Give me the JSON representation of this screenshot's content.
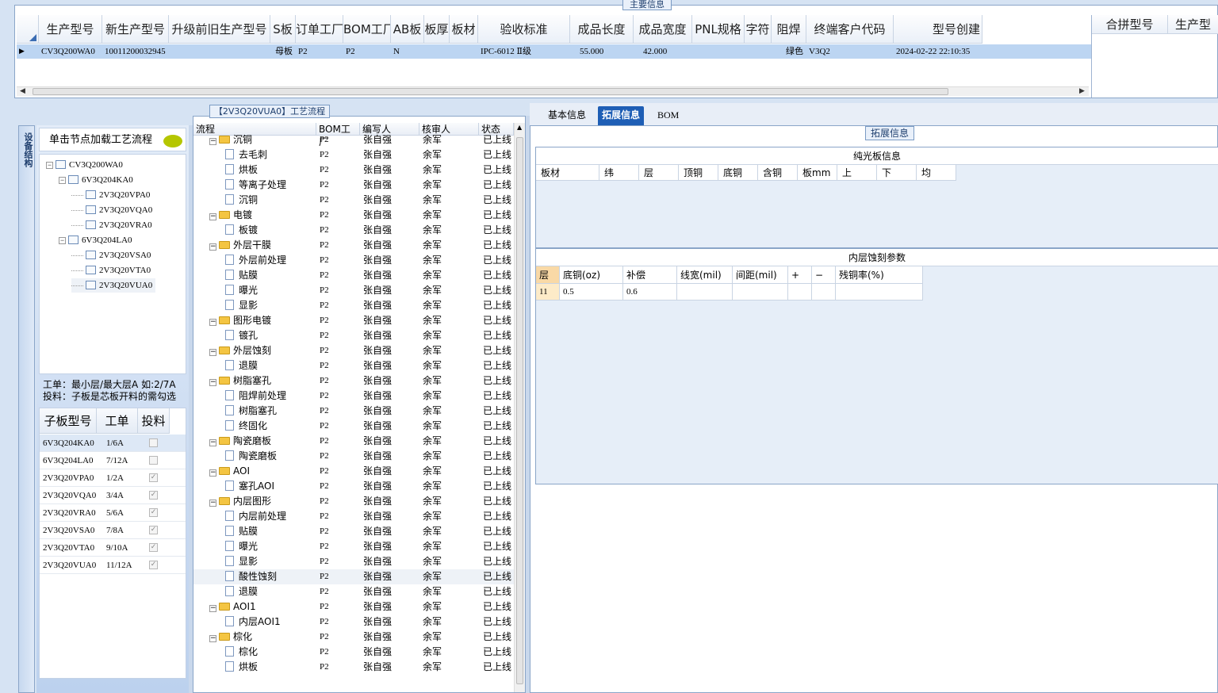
{
  "top_panel": {
    "title": "主要信息",
    "columns": [
      "生产型号",
      "新生产型号",
      "升级前旧生产型号",
      "S板",
      "订单工厂",
      "BOM工厂",
      "AB板",
      "板厚",
      "板材",
      "验收标准",
      "成品长度",
      "成品宽度",
      "PNL规格",
      "字符",
      "阻焊",
      "终端客户代码",
      "型号创建"
    ],
    "row": {
      "marker": "▶",
      "cells": [
        "CV3Q200WA0",
        "10011200032945",
        "",
        "母板",
        "P2",
        "P2",
        "N",
        "",
        "",
        "IPC-6012 Ⅱ级",
        "55.000",
        "42.000",
        "",
        "",
        "绿色",
        "V3Q2",
        "2024-02-22 22:10:35"
      ]
    },
    "merge_columns": [
      "合拼型号",
      "生产型"
    ]
  },
  "left_panel": {
    "vertical_tab": "设备结构",
    "hint": "单击节点加载工艺流程",
    "tree": [
      {
        "label": "CV3Q200WA0",
        "level": 0,
        "expander": "−"
      },
      {
        "label": "6V3Q204KA0",
        "level": 1,
        "expander": "−"
      },
      {
        "label": "2V3Q20VPA0",
        "level": 2
      },
      {
        "label": "2V3Q20VQA0",
        "level": 2
      },
      {
        "label": "2V3Q20VRA0",
        "level": 2
      },
      {
        "label": "6V3Q204LA0",
        "level": 1,
        "expander": "−"
      },
      {
        "label": "2V3Q20VSA0",
        "level": 2
      },
      {
        "label": "2V3Q20VTA0",
        "level": 2
      },
      {
        "label": "2V3Q20VUA0",
        "level": 2,
        "selected": true
      }
    ],
    "note_line1": "工单：最小层/最大层A 如:2/7A",
    "note_line2": "投料：子板是芯板开料的需勾选",
    "subgrid": {
      "headers": [
        "子板型号",
        "工单",
        "投料"
      ],
      "rows": [
        {
          "model": "6V3Q204KA0",
          "order": "1/6A",
          "feed": false,
          "selected": true
        },
        {
          "model": "6V3Q204LA0",
          "order": "7/12A",
          "feed": false
        },
        {
          "model": "2V3Q20VPA0",
          "order": "1/2A",
          "feed": true
        },
        {
          "model": "2V3Q20VQA0",
          "order": "3/4A",
          "feed": true
        },
        {
          "model": "2V3Q20VRA0",
          "order": "5/6A",
          "feed": true
        },
        {
          "model": "2V3Q20VSA0",
          "order": "7/8A",
          "feed": true
        },
        {
          "model": "2V3Q20VTA0",
          "order": "9/10A",
          "feed": true
        },
        {
          "model": "2V3Q20VUA0",
          "order": "11/12A",
          "feed": true
        }
      ]
    }
  },
  "flow_panel": {
    "title": "【2V3Q20VUA0】工艺流程",
    "headers": [
      "流程",
      "BOM工厂",
      "编写人",
      "核审人",
      "状态"
    ],
    "rows": [
      {
        "name": "沉铜",
        "type": "folder",
        "bom": "P2",
        "writer": "张自强",
        "reviewer": "余军",
        "status": "已上线"
      },
      {
        "name": "去毛刺",
        "type": "step",
        "bom": "P2",
        "writer": "张自强",
        "reviewer": "余军",
        "status": "已上线"
      },
      {
        "name": "烘板",
        "type": "step",
        "bom": "P2",
        "writer": "张自强",
        "reviewer": "余军",
        "status": "已上线"
      },
      {
        "name": "等离子处理",
        "type": "step",
        "bom": "P2",
        "writer": "张自强",
        "reviewer": "余军",
        "status": "已上线"
      },
      {
        "name": "沉铜",
        "type": "step",
        "bom": "P2",
        "writer": "张自强",
        "reviewer": "余军",
        "status": "已上线"
      },
      {
        "name": "电镀",
        "type": "folder",
        "bom": "P2",
        "writer": "张自强",
        "reviewer": "余军",
        "status": "已上线"
      },
      {
        "name": "板镀",
        "type": "step",
        "bom": "P2",
        "writer": "张自强",
        "reviewer": "余军",
        "status": "已上线"
      },
      {
        "name": "外层干膜",
        "type": "folder",
        "bom": "P2",
        "writer": "张自强",
        "reviewer": "余军",
        "status": "已上线"
      },
      {
        "name": "外层前处理",
        "type": "step",
        "bom": "P2",
        "writer": "张自强",
        "reviewer": "余军",
        "status": "已上线"
      },
      {
        "name": "贴膜",
        "type": "step",
        "bom": "P2",
        "writer": "张自强",
        "reviewer": "余军",
        "status": "已上线"
      },
      {
        "name": "曝光",
        "type": "step",
        "bom": "P2",
        "writer": "张自强",
        "reviewer": "余军",
        "status": "已上线"
      },
      {
        "name": "显影",
        "type": "step",
        "bom": "P2",
        "writer": "张自强",
        "reviewer": "余军",
        "status": "已上线"
      },
      {
        "name": "图形电镀",
        "type": "folder",
        "bom": "P2",
        "writer": "张自强",
        "reviewer": "余军",
        "status": "已上线"
      },
      {
        "name": "镀孔",
        "type": "step",
        "bom": "P2",
        "writer": "张自强",
        "reviewer": "余军",
        "status": "已上线"
      },
      {
        "name": "外层蚀刻",
        "type": "folder",
        "bom": "P2",
        "writer": "张自强",
        "reviewer": "余军",
        "status": "已上线"
      },
      {
        "name": "退膜",
        "type": "step",
        "bom": "P2",
        "writer": "张自强",
        "reviewer": "余军",
        "status": "已上线"
      },
      {
        "name": "树脂塞孔",
        "type": "folder",
        "bom": "P2",
        "writer": "张自强",
        "reviewer": "余军",
        "status": "已上线"
      },
      {
        "name": "阻焊前处理",
        "type": "step",
        "bom": "P2",
        "writer": "张自强",
        "reviewer": "余军",
        "status": "已上线"
      },
      {
        "name": "树脂塞孔",
        "type": "step",
        "bom": "P2",
        "writer": "张自强",
        "reviewer": "余军",
        "status": "已上线"
      },
      {
        "name": "终固化",
        "type": "step",
        "bom": "P2",
        "writer": "张自强",
        "reviewer": "余军",
        "status": "已上线"
      },
      {
        "name": "陶瓷磨板",
        "type": "folder",
        "bom": "P2",
        "writer": "张自强",
        "reviewer": "余军",
        "status": "已上线"
      },
      {
        "name": "陶瓷磨板",
        "type": "step",
        "bom": "P2",
        "writer": "张自强",
        "reviewer": "余军",
        "status": "已上线"
      },
      {
        "name": "AOI",
        "type": "folder",
        "bom": "P2",
        "writer": "张自强",
        "reviewer": "余军",
        "status": "已上线"
      },
      {
        "name": "塞孔AOI",
        "type": "step",
        "bom": "P2",
        "writer": "张自强",
        "reviewer": "余军",
        "status": "已上线"
      },
      {
        "name": "内层图形",
        "type": "folder",
        "bom": "P2",
        "writer": "张自强",
        "reviewer": "余军",
        "status": "已上线"
      },
      {
        "name": "内层前处理",
        "type": "step",
        "bom": "P2",
        "writer": "张自强",
        "reviewer": "余军",
        "status": "已上线"
      },
      {
        "name": "贴膜",
        "type": "step",
        "bom": "P2",
        "writer": "张自强",
        "reviewer": "余军",
        "status": "已上线"
      },
      {
        "name": "曝光",
        "type": "step",
        "bom": "P2",
        "writer": "张自强",
        "reviewer": "余军",
        "status": "已上线"
      },
      {
        "name": "显影",
        "type": "step",
        "bom": "P2",
        "writer": "张自强",
        "reviewer": "余军",
        "status": "已上线"
      },
      {
        "name": "酸性蚀刻",
        "type": "step",
        "bom": "P2",
        "writer": "张自强",
        "reviewer": "余军",
        "status": "已上线",
        "selected": true
      },
      {
        "name": "退膜",
        "type": "step",
        "bom": "P2",
        "writer": "张自强",
        "reviewer": "余军",
        "status": "已上线"
      },
      {
        "name": "AOI1",
        "type": "folder",
        "bom": "P2",
        "writer": "张自强",
        "reviewer": "余军",
        "status": "已上线"
      },
      {
        "name": "内层AOI1",
        "type": "step",
        "bom": "P2",
        "writer": "张自强",
        "reviewer": "余军",
        "status": "已上线"
      },
      {
        "name": "棕化",
        "type": "folder",
        "bom": "P2",
        "writer": "张自强",
        "reviewer": "余军",
        "status": "已上线"
      },
      {
        "name": "棕化",
        "type": "step",
        "bom": "P2",
        "writer": "张自强",
        "reviewer": "余军",
        "status": "已上线"
      },
      {
        "name": "烘板",
        "type": "step",
        "bom": "P2",
        "writer": "张自强",
        "reviewer": "余军",
        "status": "已上线"
      }
    ]
  },
  "right_panel": {
    "tabs": [
      "基本信息",
      "拓展信息",
      "BOM"
    ],
    "active_tab": "拓展信息",
    "ext_title": "拓展信息",
    "pure_title": "纯光板信息",
    "pure_headers": [
      "板材",
      "纬",
      "层",
      "顶铜",
      "底铜",
      "含铜",
      "板mm",
      "上",
      "下",
      "均"
    ],
    "etch_title": "内层蚀刻参数",
    "etch_headers": [
      "层",
      "底铜(oz)",
      "补偿",
      "线宽(mil)",
      "间距(mil)",
      "+",
      "−",
      "残铜率(%)"
    ],
    "etch_row": [
      "11",
      "0.5",
      "0.6",
      "",
      "",
      "",
      "",
      ""
    ]
  },
  "colors": {
    "selection": "#bcd5f2",
    "active_tab": "#1e5eb5",
    "folder": "#f4c542",
    "bubble": "#b5c600"
  }
}
